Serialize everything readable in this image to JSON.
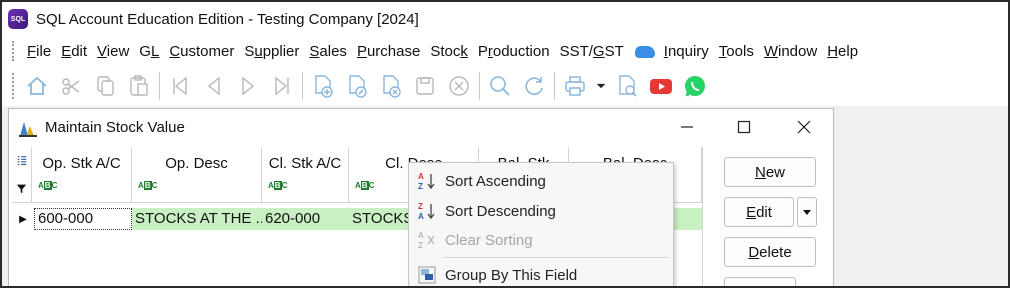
{
  "window": {
    "title": "SQL Account Education Edition - Testing Company [2024]",
    "logo_text": "SQL"
  },
  "menu": [
    {
      "pre": "",
      "u": "F",
      "post": "ile"
    },
    {
      "pre": "",
      "u": "E",
      "post": "dit"
    },
    {
      "pre": "",
      "u": "V",
      "post": "iew"
    },
    {
      "pre": "G",
      "u": "L",
      "post": ""
    },
    {
      "pre": "",
      "u": "C",
      "post": "ustomer"
    },
    {
      "pre": "S",
      "u": "u",
      "post": "pplier"
    },
    {
      "pre": "",
      "u": "S",
      "post": "ales"
    },
    {
      "pre": "",
      "u": "P",
      "post": "urchase"
    },
    {
      "pre": "Stoc",
      "u": "k",
      "post": ""
    },
    {
      "pre": "P",
      "u": "r",
      "post": "oduction"
    },
    {
      "pre": "SST/",
      "u": "G",
      "post": "ST"
    },
    {
      "pre": "",
      "u": "I",
      "post": "nquiry"
    },
    {
      "pre": "",
      "u": "T",
      "post": "ools"
    },
    {
      "pre": "",
      "u": "W",
      "post": "indow"
    },
    {
      "pre": "",
      "u": "H",
      "post": "elp"
    }
  ],
  "toolbar": {
    "icons": [
      "home-icon",
      "cut-icon",
      "copy-icon",
      "paste-icon",
      "first-record-icon",
      "previous-record-icon",
      "next-record-icon",
      "last-record-icon",
      "new-doc-icon",
      "edit-doc-icon",
      "delete-doc-icon",
      "save-icon",
      "cancel-icon",
      "search-icon",
      "refresh-icon",
      "print-icon",
      "print-dropdown-icon",
      "preview-icon",
      "youtube-icon",
      "whatsapp-icon"
    ]
  },
  "child_window": {
    "title": "Maintain Stock Value"
  },
  "grid": {
    "columns": [
      "Op. Stk A/C",
      "Op. Desc",
      "Cl. Stk A/C",
      "Cl. Desc",
      "Bal. Stk",
      "Bal. Desc"
    ],
    "rows": [
      [
        "600-000",
        "STOCKS AT THE ...",
        "620-000",
        "STOCKS A",
        "",
        ""
      ]
    ]
  },
  "buttons": {
    "new": {
      "pre": "",
      "u": "N",
      "post": "ew"
    },
    "edit": {
      "pre": "",
      "u": "E",
      "post": "dit"
    },
    "delete": {
      "pre": "",
      "u": "D",
      "post": "elete"
    }
  },
  "context_menu": {
    "items": [
      {
        "label": "Sort Ascending",
        "icon": "sort-ascending-icon",
        "enabled": true
      },
      {
        "label": "Sort Descending",
        "icon": "sort-descending-icon",
        "enabled": true
      },
      {
        "label": "Clear Sorting",
        "icon": "clear-sorting-icon",
        "enabled": false
      },
      {
        "label": "Group By This Field",
        "icon": "group-by-icon",
        "enabled": true
      }
    ]
  },
  "colors": {
    "row_highlight": "#c9f0c2",
    "abc_green": "#1e7d2b",
    "whatsapp": "#25d366",
    "youtube": "#e53935",
    "logo": "#5a2a9a"
  }
}
